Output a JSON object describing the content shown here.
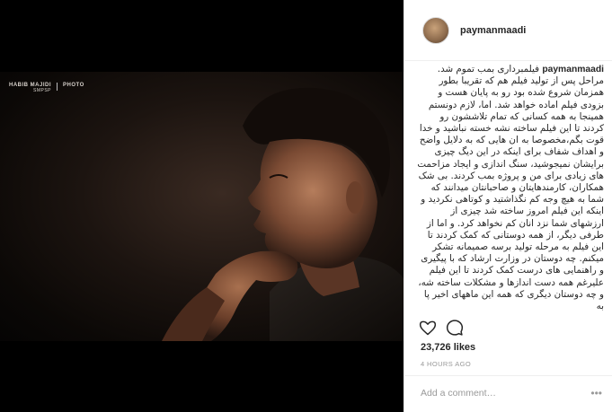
{
  "post": {
    "watermark": {
      "name": "HABIB MAJIDI",
      "sub": "SMPSP",
      "label": "PHOTO"
    },
    "author": {
      "username": "paymanmaadi"
    },
    "caption": {
      "username": "paymanmaadi",
      "text": "فیلمبرداری بمب تموم شد. مراحل پس از تولید فیلم هم که تقریبا بطور همزمان شروع شده بود رو به پایان هست و بزودی فیلم اماده خواهد شد. اما، لازم دونستم همینجا به همه کسانی که تمام تلاششون رو کردند تا این فیلم ساخته نشه خسته نباشید و خدا قوت بگم،مخصوصا به ان هایی که به دلایل واضح و اهداف شفاف برای اینکه در این دیگ چیزی برایشان نمیجوشید، سنگ اندازی و ایجاد مزاحمت های زیادی برای من و پروژه بمب کردند. بی شک همکاران، کارمندهایتان و صاحبانتان میدانند که شما به هیچ وجه کم نگذاشتید و کوتاهی نکردید و اینکه این فیلم امروز ساخته شد چیزی از ارزشهای شما نزد انان کم نخواهد کرد. و اما از طرفی دیگر، از همه دوستانی که کمک کردند تا این فیلم به مرحله تولید برسه صمیمانه تشکر میکنم. چه دوستان در وزارت ارشاد که با پیگیری و راهنمایی های درست کمک کردند تا این فیلم علیرغم همه دست اندازها و مشکلات ساخته شه، و چه دوستان دیگری که همه این ماههای اخیر پا به"
    },
    "likes": "23,726 likes",
    "timestamp": "4 HOURS AGO",
    "comment": {
      "placeholder": "Add a comment…"
    },
    "more_label": "•••"
  },
  "icons": {
    "like": "heart-icon",
    "comment": "comment-bubble-icon",
    "more": "more-options-icon"
  },
  "colors": {
    "photo_background": "#000000",
    "text": "#262626",
    "muted": "#999999",
    "border": "#efefef"
  }
}
